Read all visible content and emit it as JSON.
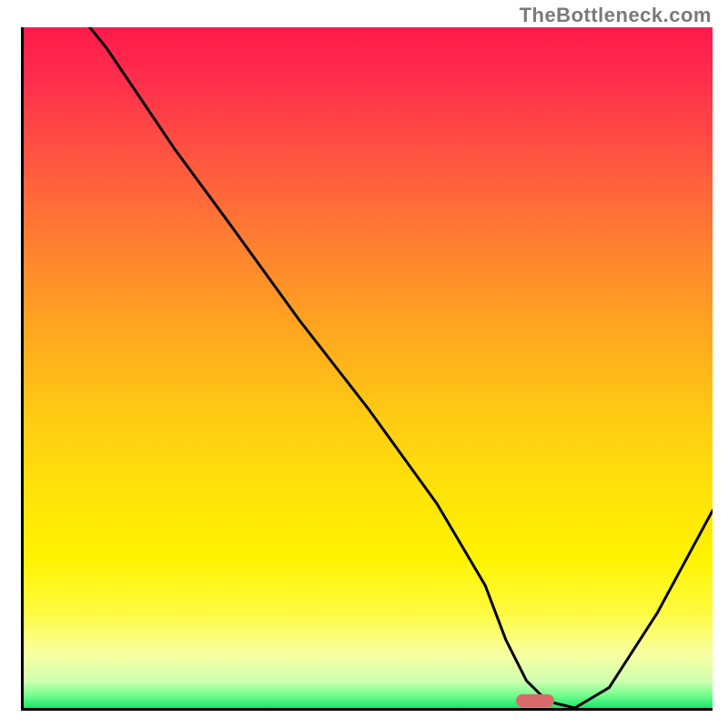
{
  "watermark": "TheBottleneck.com",
  "chart_data": {
    "type": "line",
    "title": "",
    "xlabel": "",
    "ylabel": "",
    "xlim": [
      0,
      100
    ],
    "ylim": [
      0,
      100
    ],
    "x": [
      0,
      8,
      12,
      22,
      30,
      40,
      50,
      60,
      67,
      70,
      73,
      76,
      80,
      85,
      92,
      100
    ],
    "values": [
      110,
      102,
      97,
      82,
      71,
      57,
      44,
      30,
      18,
      10,
      4,
      1,
      0,
      3,
      14,
      29
    ],
    "marker": {
      "x": 74,
      "y": 1,
      "color": "#d86a6a"
    },
    "background_gradient": {
      "top": "#ff1a4a",
      "mid": "#ffd000",
      "bottom": "#16e66a"
    },
    "annotations": []
  }
}
